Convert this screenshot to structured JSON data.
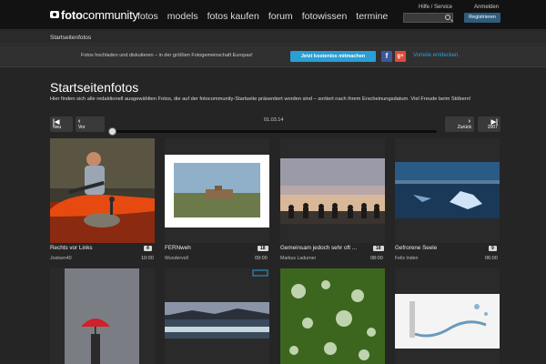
{
  "header": {
    "logo_text_bold": "foto",
    "logo_text_rest": "community",
    "nav": [
      "fotos",
      "models",
      "fotos kaufen",
      "forum",
      "fotowissen",
      "termine"
    ],
    "help_link": "Hilfe / Service",
    "login_link": "Anmelden",
    "search_placeholder": "",
    "register_label": "Registrieren"
  },
  "breadcrumb": "Startseitenfotos",
  "promo": {
    "text": "Fotos hochladen und diskutieren – in der größten Fotogemeinschaft Europas!",
    "join_label": "Jetzt kostenlos mitmachen",
    "facebook_label": "f",
    "google_label": "g+",
    "advantages_link": "Vorteile entdecken."
  },
  "page": {
    "title": "Startseitenfotos",
    "intro": "Hier finden sich alle redaktionell ausgewählten Fotos, die auf der fotocommunity-Startseite präsentiert worden sind – sortiert nach ihrem Erscheinungsdatum. Viel Freude beim Stöbern!"
  },
  "timeline": {
    "newest_label": "Neu",
    "prev_label": "Vor",
    "date": "01.03.14",
    "back_label": "Zurück",
    "year_label": "2007"
  },
  "photos": [
    {
      "title": "Rechts vor Links",
      "author": "Jostsen40",
      "count": "4",
      "time": "10:00"
    },
    {
      "title": "FERNweh",
      "author": "Wundervoll",
      "count": "18",
      "time": "09:00"
    },
    {
      "title": "Gemeinsam jedoch sehr oft ...",
      "author": "Markus Ladurner",
      "count": "18",
      "time": "08:00"
    },
    {
      "title": "Gefrorene Seele",
      "author": "Felix Inden",
      "count": "9",
      "time": "06:00"
    }
  ],
  "colors": {
    "accent": "#2a9fd6",
    "facebook": "#3b5998",
    "google": "#dd4b39",
    "register": "#2e5c7a"
  }
}
